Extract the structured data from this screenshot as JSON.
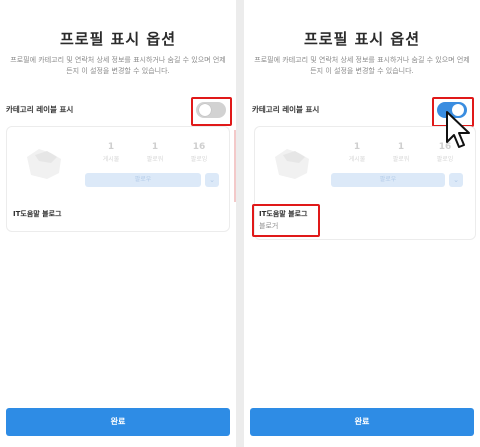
{
  "left": {
    "title": "프로필 표시 옵션",
    "description": "프로필에 카테고리 및 연락처 상세 정보를 표시하거나 숨길 수 있으며 언제든지 이 설정을 변경할 수 있습니다.",
    "option_label": "카테고리 레이블 표시",
    "toggle_state": "off",
    "profile": {
      "stats": [
        {
          "value": "1",
          "label": "게시물"
        },
        {
          "value": "1",
          "label": "팔로워"
        },
        {
          "value": "16",
          "label": "팔로잉"
        }
      ],
      "follow_label": "팔로우",
      "name": "IT도움말 블로그"
    },
    "done_label": "완료"
  },
  "right": {
    "title": "프로필 표시 옵션",
    "description": "프로필에 카테고리 및 연락처 상세 정보를 표시하거나 숨길 수 있으며 언제든지 이 설정을 변경할 수 있습니다.",
    "option_label": "카테고리 레이블 표시",
    "toggle_state": "on",
    "profile": {
      "stats": [
        {
          "value": "1",
          "label": "게시물"
        },
        {
          "value": "1",
          "label": "팔로워"
        },
        {
          "value": "16",
          "label": "팔로잉"
        }
      ],
      "follow_label": "팔로우",
      "name": "IT도움말 블로그",
      "category": "블로거"
    },
    "done_label": "완료"
  },
  "colors": {
    "highlight": "#e01919",
    "accent": "#2e8ce5",
    "toggle_on": "#3a8de0",
    "toggle_off": "#d2d2d2"
  }
}
